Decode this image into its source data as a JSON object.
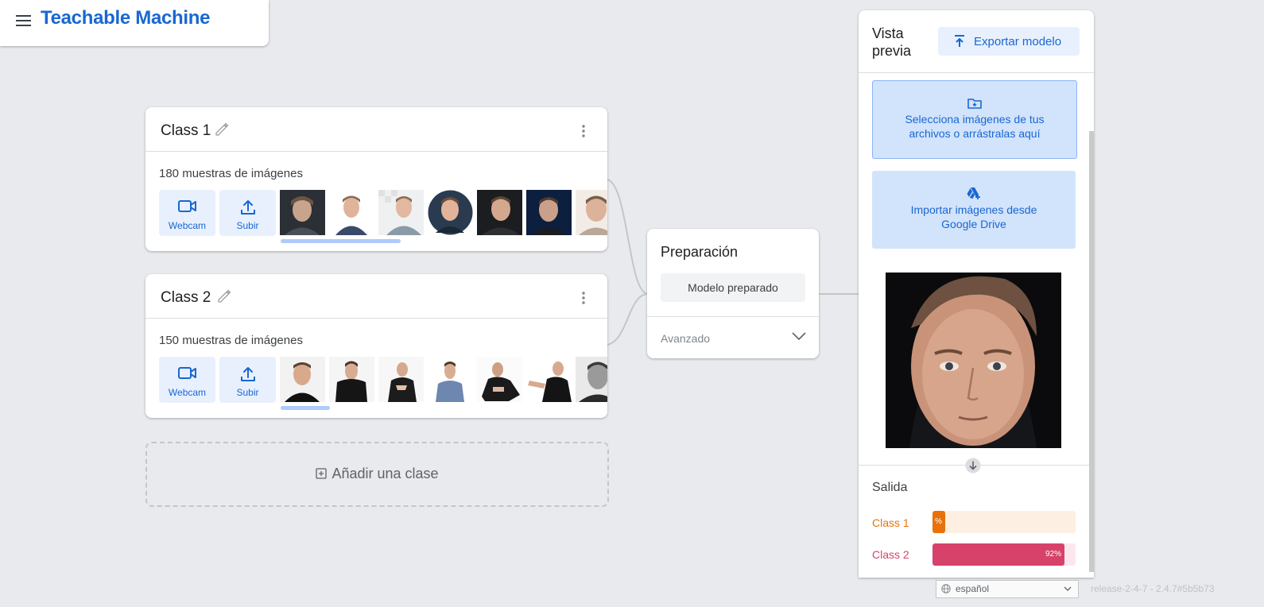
{
  "header": {
    "title": "Teachable Machine"
  },
  "classes": [
    {
      "name": "Class 1",
      "samples": "180 muestras de imágenes",
      "webcam": "Webcam",
      "upload": "Subir"
    },
    {
      "name": "Class 2",
      "samples": "150 muestras de imágenes",
      "webcam": "Webcam",
      "upload": "Subir"
    }
  ],
  "add_class": {
    "label": "Añadir una clase"
  },
  "training": {
    "title": "Preparación",
    "button": "Modelo preparado",
    "advanced": "Avanzado"
  },
  "preview": {
    "title": "Vista previa",
    "export_button": "Exportar modelo",
    "file_option": "Selecciona imágenes de tus archivos o arrástralas aquí",
    "drive_option": "Importar imágenes desde Google Drive",
    "output_title": "Salida",
    "outputs": [
      {
        "label": "Class 1",
        "value_text": "%",
        "fraction": 0.08,
        "color": "#e8710a",
        "track": "#feefe3"
      },
      {
        "label": "Class 2",
        "value_text": "92%",
        "fraction": 0.92,
        "color": "#d7426a",
        "track": "#fde7ee"
      }
    ]
  },
  "footer": {
    "language": "español",
    "version": "release-2-4-7 - 2.4.7#5b5b73"
  },
  "colors": {
    "brand": "#1967d2",
    "accent_bg": "#e8f0fe",
    "page_bg": "#e8eaed"
  },
  "icons": [
    "menu-icon",
    "pencil-icon",
    "more-vert-icon",
    "videocam-icon",
    "upload-icon",
    "chevron-down-icon",
    "file-upload-icon",
    "folder-add-icon",
    "drive-add-icon",
    "arrow-down-circle-icon",
    "globe-icon"
  ]
}
